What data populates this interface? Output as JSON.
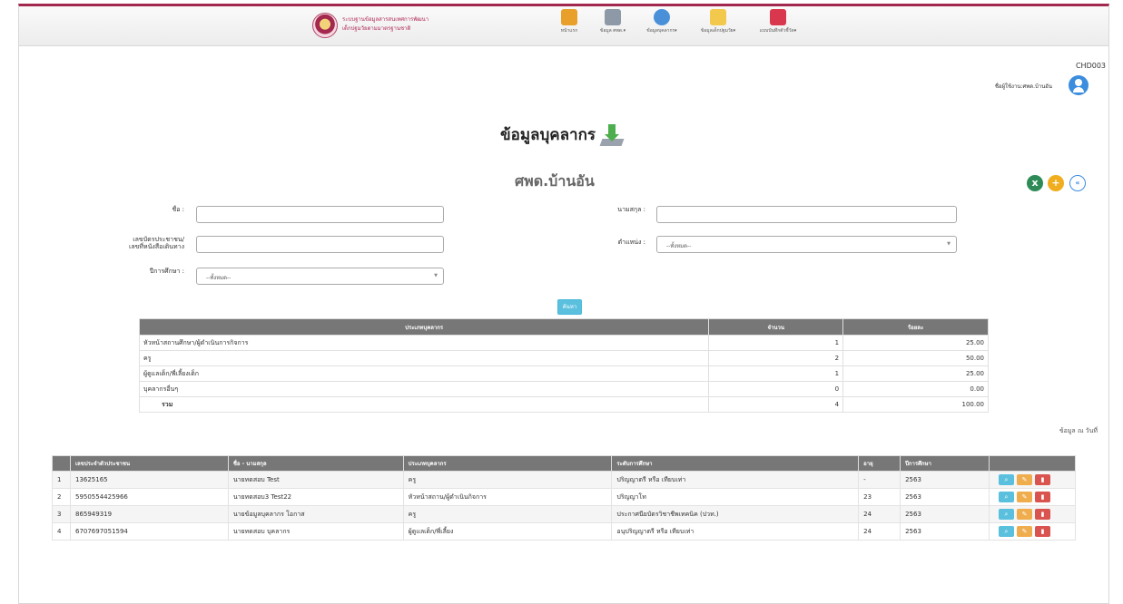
{
  "nav": {
    "brand_line1": "ระบบฐานข้อมูลสารสนเทศการพัฒนา",
    "brand_line2": "เด็กปฐมวัยตามมาตรฐานชาติ",
    "items": [
      {
        "label": "หน้าแรก",
        "icon": "home-icon",
        "color": "#e8a02b"
      },
      {
        "label": "ข้อมูล ศพด.▾",
        "icon": "school-icon",
        "color": "#8d99a6"
      },
      {
        "label": "ข้อมูลบุคลากร▾",
        "icon": "personnel-icon",
        "color": "#4a90d9"
      },
      {
        "label": "ข้อมูลเด็กปฐมวัย▾",
        "icon": "children-folder-icon",
        "color": "#f2c94c"
      },
      {
        "label": "แบบบันทึกตัวชี้วัด▾",
        "icon": "indicator-book-icon",
        "color": "#d9374e"
      }
    ]
  },
  "header": {
    "code": "CHD003",
    "user_label": "ชื่อผู้ใช้งาน:ศพด.บ้านอัน"
  },
  "page": {
    "title": "ข้อมูลบุคลากร",
    "center_name": "ศพด.บ้านอัน"
  },
  "colors": {
    "excel": "#2e8b57",
    "add": "#f0ad1e",
    "back": "#3c8dde",
    "accent": "#a3284d"
  },
  "form": {
    "first_name_label": "ชื่อ :",
    "last_name_label": "นามสกุล :",
    "id_label_1": "เลขบัตรประชาชน/",
    "id_label_2": "เลขที่หนังสือเดินทาง",
    "position_label": "ตำแหน่ง :",
    "position_value": "--ทั้งหมด--",
    "year_label": "ปีการศึกษา :",
    "year_value": "--ทั้งหมด--",
    "search_label": "ค้นหา"
  },
  "summary": {
    "headers": [
      "ประเภทบุคลากร",
      "จำนวน",
      "ร้อยละ"
    ],
    "rows": [
      {
        "type": "หัวหน้าสถานศึกษา/ผู้ดำเนินการกิจการ",
        "count": "1",
        "percent": "25.00"
      },
      {
        "type": "ครู",
        "count": "2",
        "percent": "50.00"
      },
      {
        "type": "ผู้ดูแลเด็ก/พี่เลี้ยงเด็ก",
        "count": "1",
        "percent": "25.00"
      },
      {
        "type": "บุคลากรอื่นๆ",
        "count": "0",
        "percent": "0.00"
      }
    ],
    "total": {
      "label": "รวม",
      "count": "4",
      "percent": "100.00"
    },
    "note": "ข้อมูล ณ วันที่"
  },
  "staff": {
    "headers": [
      "",
      "เลขประจำตัวประชาชน",
      "ชื่อ - นามสกุล",
      "ประเภทบุคลากร",
      "ระดับการศึกษา",
      "อายุ",
      "ปีการศึกษา",
      ""
    ],
    "rows": [
      {
        "no": "1",
        "id": "13625165",
        "name": "นายทดสอบ Test",
        "type": "ครู",
        "edu": "ปริญญาตรี หรือ เทียบเท่า",
        "age": "-",
        "year": "2563"
      },
      {
        "no": "2",
        "id": "5950554425966",
        "name": "นายทดสอบ3 Test22",
        "type": "หัวหน้าสถาน/ผู้ดำเนินกิจการ",
        "edu": "ปริญญาโท",
        "age": "23",
        "year": "2563"
      },
      {
        "no": "3",
        "id": "865949319",
        "name": "นายข้อมูลบุคลากร โอกาส",
        "type": "ครู",
        "edu": "ประกาศนียบัตรวิชาชีพเทคนิค (ปวท.)",
        "age": "24",
        "year": "2563"
      },
      {
        "no": "4",
        "id": "6707697051594",
        "name": "นายทดสอบ บุคลากร",
        "type": "ผู้ดูแลเด็ก/พี่เลี้ยง",
        "edu": "อนุปริญญาตรี หรือ เทียบเท่า",
        "age": "24",
        "year": "2563"
      }
    ]
  }
}
